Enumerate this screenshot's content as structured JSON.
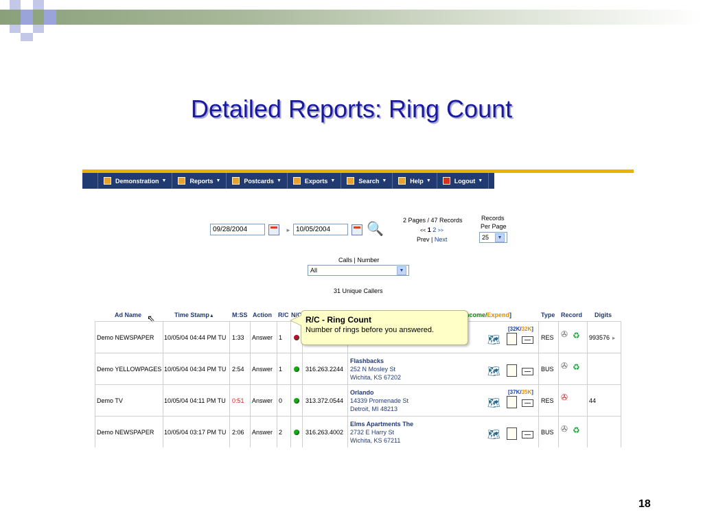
{
  "slide": {
    "title": "Detailed Reports:  Ring Count",
    "page_number": "18"
  },
  "nav": {
    "items": [
      {
        "label": "Demonstration",
        "icon": "user-icon"
      },
      {
        "label": "Reports",
        "icon": "reports-icon"
      },
      {
        "label": "Postcards",
        "icon": "postcards-icon"
      },
      {
        "label": "Exports",
        "icon": "exports-icon"
      },
      {
        "label": "Search",
        "icon": "search-icon"
      },
      {
        "label": "Help",
        "icon": "help-icon"
      },
      {
        "label": "Logout",
        "icon": "logout-icon"
      }
    ]
  },
  "filters": {
    "start_date": "09/28/2004",
    "end_date": "10/05/2004",
    "pages_summary": "2 Pages / 47 Records",
    "pager_prev_arrows": "<<",
    "pager_current": "1",
    "pager_page2": "2",
    "pager_next_arrows": ">>",
    "prev_label": "Prev",
    "next_label": "Next",
    "records_label_1": "Records",
    "records_label_2": "Per Page",
    "records_per_page": "25",
    "calls_label": "Calls | Number",
    "calls_value": "All",
    "unique_callers": "31 Unique Callers"
  },
  "table": {
    "headers": {
      "ad_name": "Ad Name",
      "time_stamp": "Time Stamp",
      "sort_arrow": "▲",
      "mss": "M:SS",
      "action": "Action",
      "rc": "R/C",
      "nc": "N/C",
      "income": "ncome/",
      "expend": "Expend",
      "bracket": "]",
      "type": "Type",
      "record": "Record",
      "digits": "Digits"
    },
    "rows": [
      {
        "ad": "Demo NEWSPAPER",
        "time": "10/05/04 04:44 PM TU",
        "mss": "1:33",
        "action": "Answer",
        "rc": "1",
        "status": "red",
        "phone": "",
        "name": "",
        "street": "",
        "city": "",
        "income": "32K",
        "expend": "32K",
        "type": "RES",
        "digits": "993576",
        "has_recycle": true
      },
      {
        "ad": "Demo YELLOWPAGES",
        "time": "10/05/04 04:34 PM TU",
        "mss": "2:54",
        "action": "Answer",
        "rc": "1",
        "status": "green",
        "phone": "316.263.2244",
        "name": "Flashbacks",
        "street": "252 N Mosley St",
        "city": "Wichita, KS 67202",
        "income": "",
        "expend": "",
        "type": "BUS",
        "digits": "",
        "has_recycle": true
      },
      {
        "ad": "Demo TV",
        "time": "10/05/04 04:11 PM TU",
        "mss": "0:51",
        "action": "Answer",
        "rc": "0",
        "status": "green",
        "phone": "313.372.0544",
        "name": "Orlando",
        "street": "14339 Promenade St",
        "city": "Detroit, MI 48213",
        "income": "37K",
        "expend": "35K",
        "type": "RES",
        "digits": "44",
        "has_recycle": false
      },
      {
        "ad": "Demo NEWSPAPER",
        "time": "10/05/04 03:17 PM TU",
        "mss": "2:06",
        "action": "Answer",
        "rc": "2",
        "status": "green",
        "phone": "316.263.4002",
        "name": "Elms Apartments The",
        "street": "2732 E Harry St",
        "city": "Wichita, KS 67211",
        "income": "",
        "expend": "",
        "type": "BUS",
        "digits": "",
        "has_recycle": true
      }
    ]
  },
  "tooltip": {
    "title": "R/C - Ring Count",
    "text": "Number of rings before you answered."
  },
  "colors": {
    "title_blue": "#1a1aa0",
    "nav_bg": "#223a72",
    "accent_gold": "#e8b400",
    "tooltip_bg": "#ffffc8"
  }
}
